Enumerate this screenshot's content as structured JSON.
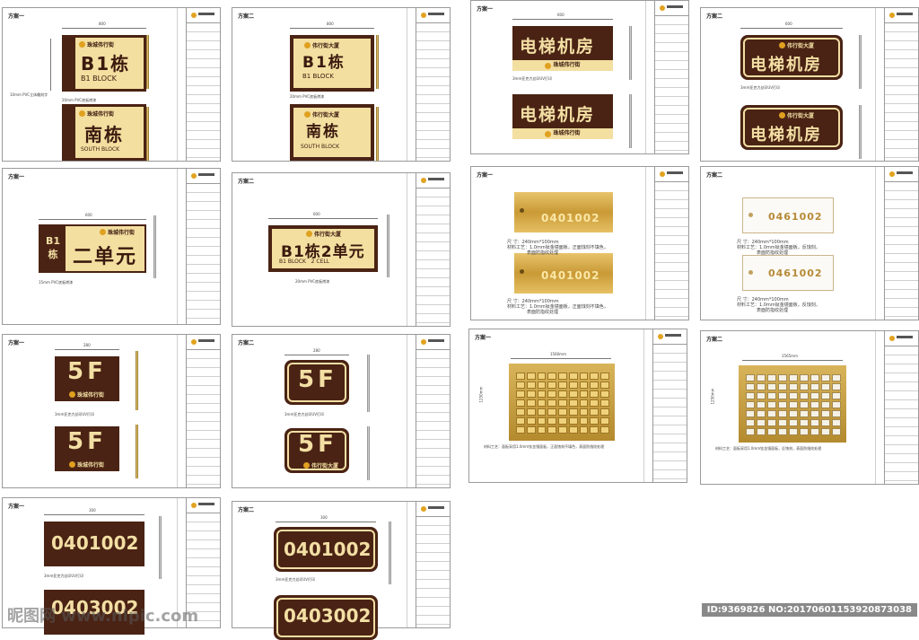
{
  "sheets": {
    "s1": {
      "label": "方案一",
      "dim": "800",
      "note1": "10mm PVC立体雕刻字",
      "note2": "20mm PVC底板烤漆",
      "brand": "珠城伟行街",
      "sign1_cn": "B1栋",
      "sign1_en": "B1 BLOCK",
      "sign2_cn": "南栋",
      "sign2_en": "SOUTH BLOCK"
    },
    "s2": {
      "label": "方案二",
      "dim": "800",
      "note1": "20mm PVC底板烤漆",
      "brand": "伟行街大厦",
      "sign1_cn": "B1栋",
      "sign1_en": "B1 BLOCK",
      "sign2_cn": "南栋",
      "sign2_en": "SOUTH BLOCK"
    },
    "s3": {
      "label": "方案一",
      "dim": "600",
      "note1": "3mm亚克力丝印UV打印",
      "sign_text": "电梯机房",
      "brand": "珠城伟行街"
    },
    "s4": {
      "label": "方案二",
      "dim": "600",
      "note1": "3mm亚克力丝印UV打印",
      "sign_text": "电梯机房",
      "brand": "伟行街大厦"
    },
    "s5": {
      "label": "方案一",
      "dim": "600",
      "left_a": "B1",
      "left_b": "栋",
      "sign_text": "二单元",
      "brand": "珠城伟行街",
      "note1": "15mm PVC底板烤漆"
    },
    "s6": {
      "label": "方案二",
      "dim": "600",
      "sign_text": "B1栋2单元",
      "sign_en": "B1 BLOCK   2 CELL",
      "brand": "伟行街大厦",
      "note1": "20mm PVC底板烤漆"
    },
    "s7": {
      "label": "方案一",
      "number": "0401002",
      "spec_size": "尺    寸：240mm*100mm",
      "spec_mat": "材料工艺：1.0mm钛金镜面板，正面蚀刻不填色，",
      "spec_mat2": "表面防指纹处理"
    },
    "s8": {
      "label": "方案二",
      "number": "0461002",
      "spec_size": "尺    寸：240mm*100mm",
      "spec_mat": "材料工艺：1.0mm钛金镜面板，反蚀刻，",
      "spec_mat2": "表面防指纹处理"
    },
    "s9": {
      "label": "方案一",
      "dim": "280",
      "sign_text": "5F",
      "brand": "珠城伟行街",
      "note1": "3mm亚克力丝印UV打印"
    },
    "s10": {
      "label": "方案二",
      "dim": "280",
      "sign_text": "5F",
      "brand": "伟行街大厦",
      "note1": "3mm亚克力丝印UV打印"
    },
    "s11": {
      "label": "方案一",
      "dim_w": "1560mm",
      "dim_h": "1250mm",
      "spec": "材料工艺：面板采用1.0mm钛金镜面板，正面蚀刻不填色，表面防指纹处理"
    },
    "s12": {
      "label": "方案二",
      "dim_w": "1565mm",
      "dim_h": "1250mm",
      "spec": "材料工艺：面板采用1.0mm钛金镜面板，反蚀刻，表面防指纹处理"
    },
    "s13": {
      "label": "方案一",
      "dim": "300",
      "number1": "0401002",
      "number2": "0403002",
      "note1": "3mm亚克力丝印UV打印"
    },
    "s14": {
      "label": "方案二",
      "dim": "300",
      "number1": "0401002",
      "number2": "0403002",
      "note1": "3mm亚克力丝印UV打印"
    }
  },
  "watermark": {
    "left": "昵图网 www.nipic.com",
    "right": "ID:9369826 NO:20170601153920873038"
  },
  "colors": {
    "brown": "#4a2314",
    "cream": "#f3dfa0",
    "gold": "#d4a84b"
  }
}
